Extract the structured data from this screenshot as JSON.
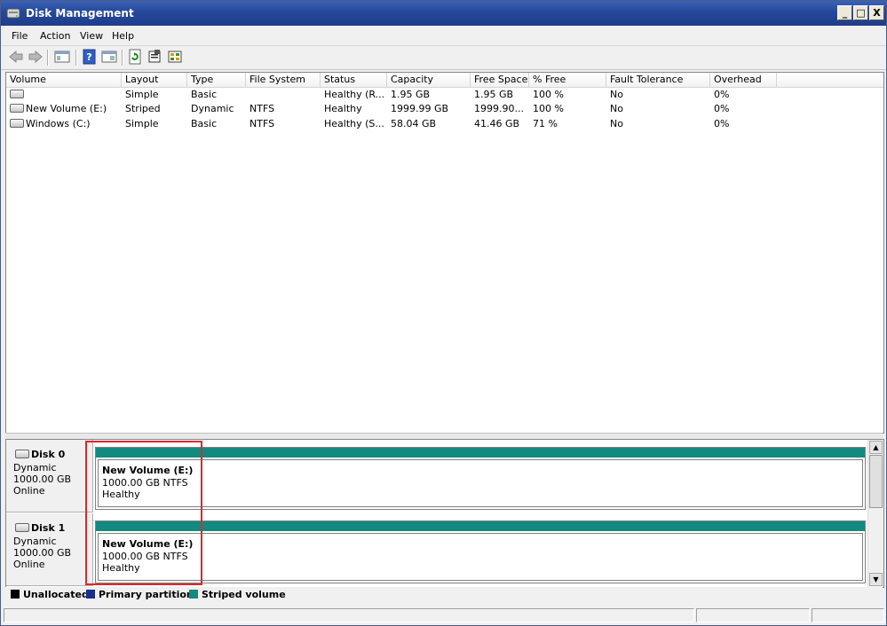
{
  "window": {
    "title": "Disk Management",
    "controls": {
      "minimize": "_",
      "maximize": "□",
      "close": "X"
    }
  },
  "menu": [
    "File",
    "Action",
    "View",
    "Help"
  ],
  "toolbar": [
    "back-icon",
    "forward-icon",
    "console-tree-icon",
    "help-icon",
    "properties-pane-icon",
    "refresh-icon",
    "settings-icon",
    "rescan-icon"
  ],
  "columns": [
    "Volume",
    "Layout",
    "Type",
    "File System",
    "Status",
    "Capacity",
    "Free Space",
    "% Free",
    "Fault Tolerance",
    "Overhead"
  ],
  "volumes": [
    {
      "volume": "",
      "layout": "Simple",
      "type": "Basic",
      "fs": "",
      "status": "Healthy (R...",
      "capacity": "1.95 GB",
      "free": "1.95 GB",
      "pct": "100 %",
      "fault": "No",
      "overhead": "0%"
    },
    {
      "volume": "New Volume (E:)",
      "layout": "Striped",
      "type": "Dynamic",
      "fs": "NTFS",
      "status": "Healthy",
      "capacity": "1999.99 GB",
      "free": "1999.90...",
      "pct": "100 %",
      "fault": "No",
      "overhead": "0%"
    },
    {
      "volume": "Windows (C:)",
      "layout": "Simple",
      "type": "Basic",
      "fs": "NTFS",
      "status": "Healthy (S...",
      "capacity": "58.04 GB",
      "free": "41.46 GB",
      "pct": "71 %",
      "fault": "No",
      "overhead": "0%"
    }
  ],
  "disks": [
    {
      "name": "Disk 0",
      "kind": "Dynamic",
      "size": "1000.00 GB",
      "state": "Online",
      "part_name": "New Volume  (E:)",
      "part_size": "1000.00 GB NTFS",
      "part_status": "Healthy"
    },
    {
      "name": "Disk 1",
      "kind": "Dynamic",
      "size": "1000.00 GB",
      "state": "Online",
      "part_name": "New Volume  (E:)",
      "part_size": "1000.00 GB NTFS",
      "part_status": "Healthy"
    }
  ],
  "legend": [
    {
      "label": "Unallocated",
      "color": "#000000"
    },
    {
      "label": "Primary partition",
      "color": "#1a2d8c"
    },
    {
      "label": "Striped volume",
      "color": "#138a7f"
    }
  ],
  "colors": {
    "titlebar": "#26479a",
    "striped": "#138a7f",
    "highlight": "#e0272b"
  }
}
